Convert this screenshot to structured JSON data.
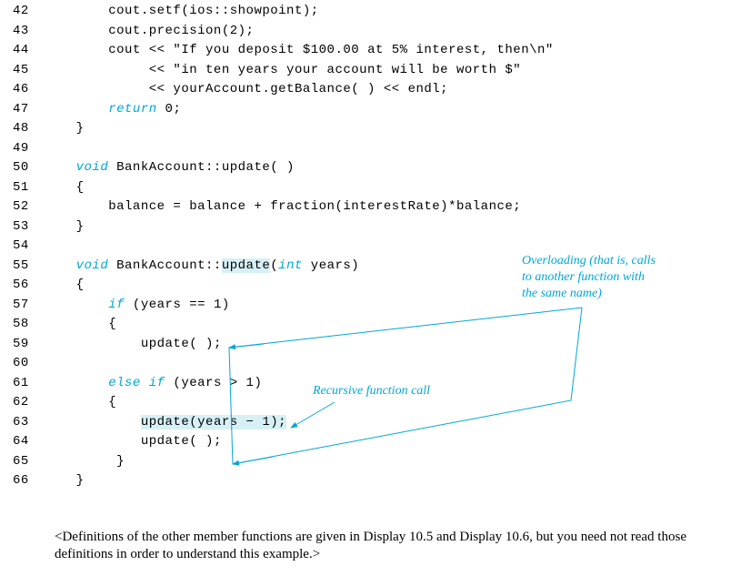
{
  "code": {
    "lines": [
      {
        "n": "42",
        "indent": "        ",
        "tokens": [
          {
            "t": "cout.setf(ios::showpoint);"
          }
        ]
      },
      {
        "n": "43",
        "indent": "        ",
        "tokens": [
          {
            "t": "cout.precision(2);"
          }
        ]
      },
      {
        "n": "44",
        "indent": "        ",
        "tokens": [
          {
            "t": "cout << \"If you deposit $100.00 at 5% interest, then\\n\""
          }
        ]
      },
      {
        "n": "45",
        "indent": "             ",
        "tokens": [
          {
            "t": "<< \"in ten years your account will be worth $\""
          }
        ]
      },
      {
        "n": "46",
        "indent": "             ",
        "tokens": [
          {
            "t": "<< yourAccount.getBalance( ) << endl;"
          }
        ]
      },
      {
        "n": "47",
        "indent": "        ",
        "tokens": [
          {
            "t": "return",
            "kw": true
          },
          {
            "t": " 0;"
          }
        ]
      },
      {
        "n": "48",
        "indent": "    ",
        "tokens": [
          {
            "t": "}"
          }
        ]
      },
      {
        "n": "49",
        "indent": "",
        "tokens": []
      },
      {
        "n": "50",
        "indent": "    ",
        "tokens": [
          {
            "t": "void",
            "kw": true
          },
          {
            "t": " BankAccount::update( )"
          }
        ]
      },
      {
        "n": "51",
        "indent": "    ",
        "tokens": [
          {
            "t": "{"
          }
        ]
      },
      {
        "n": "52",
        "indent": "        ",
        "tokens": [
          {
            "t": "balance = balance + fraction(interestRate)*balance;"
          }
        ]
      },
      {
        "n": "53",
        "indent": "    ",
        "tokens": [
          {
            "t": "}"
          }
        ]
      },
      {
        "n": "54",
        "indent": "",
        "tokens": []
      },
      {
        "n": "55",
        "indent": "    ",
        "tokens": [
          {
            "t": "void",
            "kw": true
          },
          {
            "t": " BankAccount::"
          },
          {
            "t": "update",
            "hl": true
          },
          {
            "t": "("
          },
          {
            "t": "int",
            "kw": true
          },
          {
            "t": " years)"
          }
        ]
      },
      {
        "n": "56",
        "indent": "    ",
        "tokens": [
          {
            "t": "{"
          }
        ]
      },
      {
        "n": "57",
        "indent": "        ",
        "tokens": [
          {
            "t": "if",
            "kw": true
          },
          {
            "t": " (years == 1)"
          }
        ]
      },
      {
        "n": "58",
        "indent": "        ",
        "tokens": [
          {
            "t": "{"
          }
        ]
      },
      {
        "n": "59",
        "indent": "            ",
        "tokens": [
          {
            "t": "update( );"
          }
        ]
      },
      {
        "n": "60",
        "indent": "",
        "tokens": []
      },
      {
        "n": "61",
        "indent": "        ",
        "tokens": [
          {
            "t": "else if",
            "kw": true
          },
          {
            "t": " (years > 1)"
          }
        ]
      },
      {
        "n": "62",
        "indent": "        ",
        "tokens": [
          {
            "t": "{"
          }
        ]
      },
      {
        "n": "63",
        "indent": "            ",
        "tokens": [
          {
            "t": "update(years − 1);",
            "hl": true
          }
        ]
      },
      {
        "n": "64",
        "indent": "            ",
        "tokens": [
          {
            "t": "update( );"
          }
        ]
      },
      {
        "n": "65",
        "indent": "         ",
        "tokens": [
          {
            "t": "}"
          }
        ]
      },
      {
        "n": "66",
        "indent": "    ",
        "tokens": [
          {
            "t": "}"
          }
        ]
      }
    ]
  },
  "annotations": {
    "overloading_l1": "Overloading (that is, calls",
    "overloading_l2": "to another function with",
    "overloading_l3": "the same name)",
    "recursive": "Recursive function call"
  },
  "footnote": "<Definitions of the other member functions are given in Display 10.5 and Display 10.6, but you need not read those definitions in order to understand this example.>",
  "colors": {
    "keyword": "#00a6d6",
    "highlight": "#d6f0f5",
    "arrow": "#00a6d6"
  }
}
